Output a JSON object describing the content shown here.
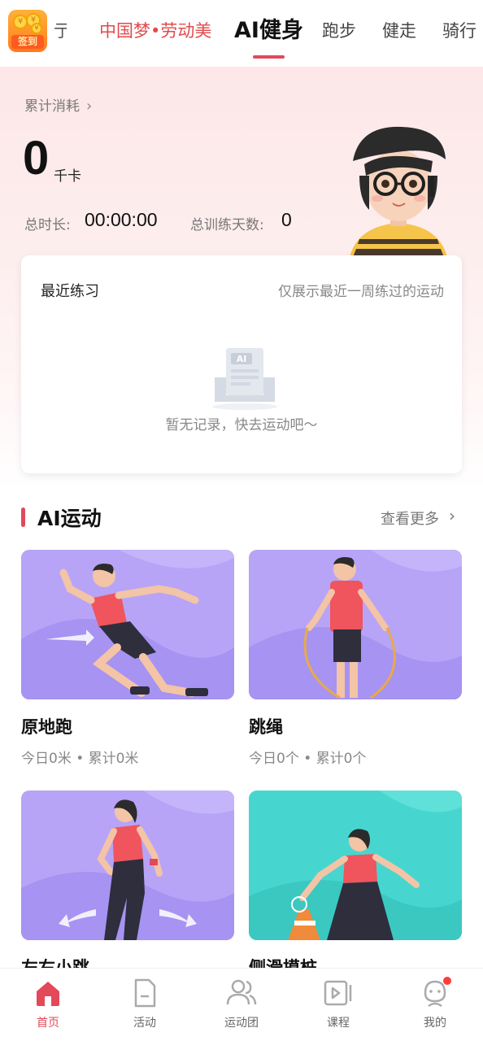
{
  "colors": {
    "accent": "#e2495b",
    "promo_text": "#e14b4b",
    "hero_bg": "#fde7e8",
    "card_purple": "#b39cf5",
    "card_teal": "#47d6cf"
  },
  "top_tabs": {
    "sign_in_label": "签到",
    "partial_tab": "亍",
    "items": [
      {
        "label": "中国梦•劳动美"
      },
      {
        "label": "AI健身"
      },
      {
        "label": "跑步"
      },
      {
        "label": "健走"
      },
      {
        "label": "骑行"
      }
    ],
    "active_index": 1
  },
  "stats": {
    "cumulative_label": "累计消耗",
    "calories_value": "0",
    "calories_unit": "千卡",
    "duration_label": "总时长:",
    "duration_value": "00:00:00",
    "days_label": "总训练天数:",
    "days_value": "0"
  },
  "recent": {
    "title": "最近练习",
    "hint": "仅展示最近一周练过的运动",
    "empty_text": "暂无记录，快去运动吧～",
    "empty_icon_label": "AI"
  },
  "ai_sport": {
    "title": "AI运动",
    "more_label": "查看更多",
    "cards": [
      {
        "name": "原地跑",
        "stats": "今日0米 • 累计0米"
      },
      {
        "name": "跳绳",
        "stats": "今日0个 • 累计0个"
      },
      {
        "name": "左右小跳",
        "stats": ""
      },
      {
        "name": "侧滑摸桩",
        "stats": ""
      }
    ]
  },
  "bottom_nav": {
    "items": [
      {
        "label": "首页",
        "icon": "home-icon"
      },
      {
        "label": "活动",
        "icon": "activity-icon"
      },
      {
        "label": "运动团",
        "icon": "group-icon"
      },
      {
        "label": "课程",
        "icon": "course-icon"
      },
      {
        "label": "我的",
        "icon": "profile-icon"
      }
    ],
    "active_index": 0
  }
}
